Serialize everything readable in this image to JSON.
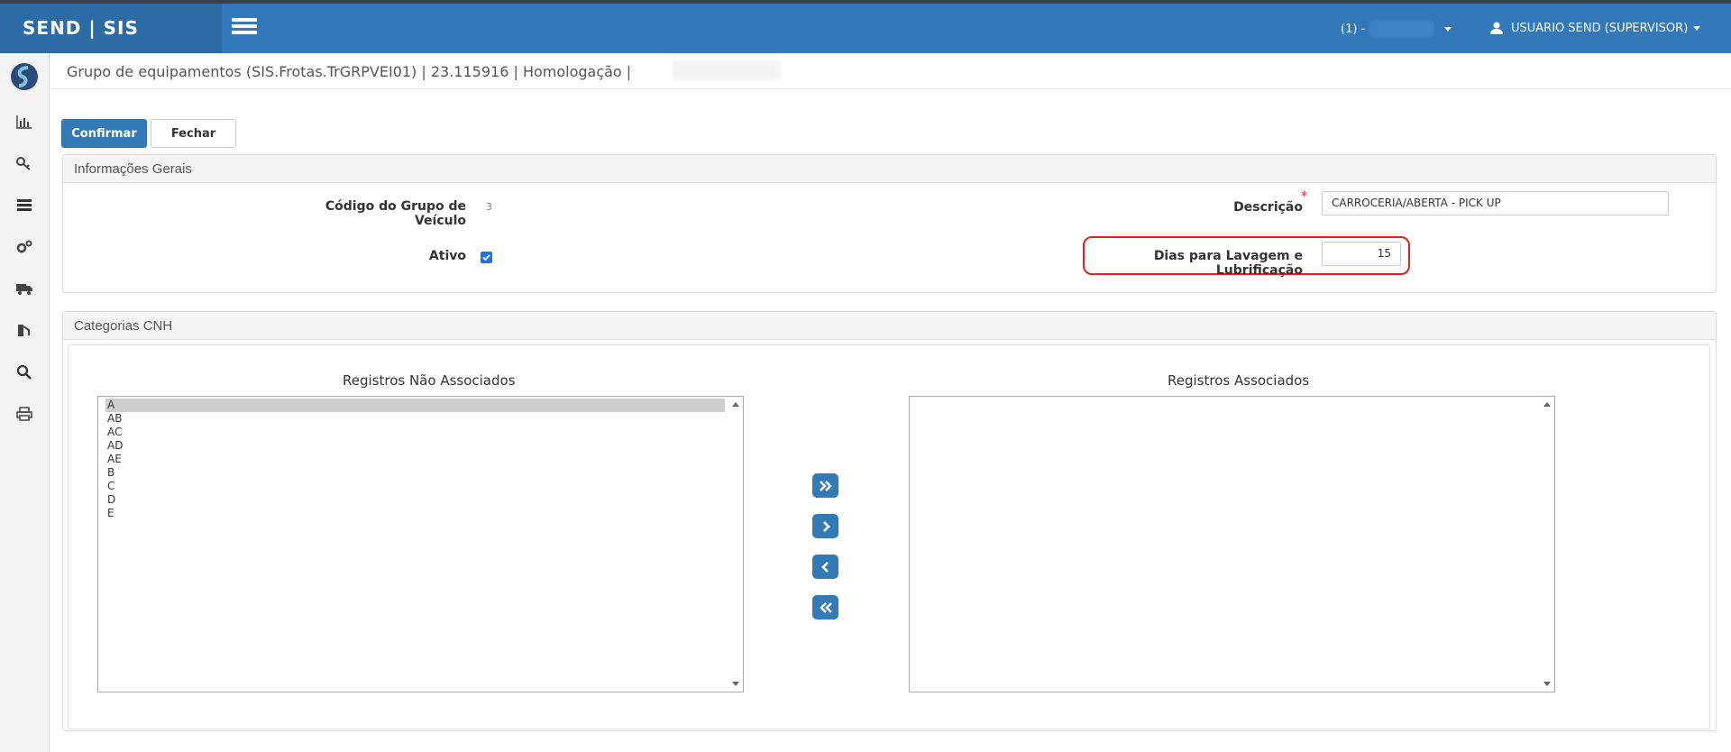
{
  "app": {
    "brand": "SEND | SIS"
  },
  "header": {
    "tenant_label": "(1) -",
    "user_label": "USUARIO SEND (SUPERVISOR)"
  },
  "page": {
    "title": "Grupo de equipamentos (SIS.Frotas.TrGRPVEI01) | 23.115916 | Homologação |"
  },
  "toolbar": {
    "confirm_label": "Confirmar",
    "close_label": "Fechar"
  },
  "general": {
    "heading": "Informações Gerais",
    "code_label": "Código do Grupo de Veículo",
    "code_value": "3",
    "description_label": "Descrição",
    "description_required": "*",
    "description_value": "CARROCERIA/ABERTA - PICK UP",
    "active_label": "Ativo",
    "active_checked": true,
    "days_label": "Dias para Lavagem e Lubrificação",
    "days_value": "15"
  },
  "cnh": {
    "heading": "Categorias CNH",
    "unassociated_title": "Registros Não Associados",
    "associated_title": "Registros Associados",
    "unassociated_items": [
      "A",
      "AB",
      "AC",
      "AD",
      "AE",
      "B",
      "C",
      "D",
      "E"
    ],
    "associated_items": []
  },
  "colors": {
    "primary": "#337ab7",
    "header": "#3379b9",
    "highlight": "#e2231a"
  },
  "icons": [
    "menu-icon",
    "chart-icon",
    "key-icon",
    "list-icon",
    "gears-icon",
    "truck-icon",
    "fuel-icon",
    "search-icon",
    "print-icon",
    "user-icon",
    "double-right-icon",
    "right-icon",
    "left-icon",
    "double-left-icon"
  ]
}
